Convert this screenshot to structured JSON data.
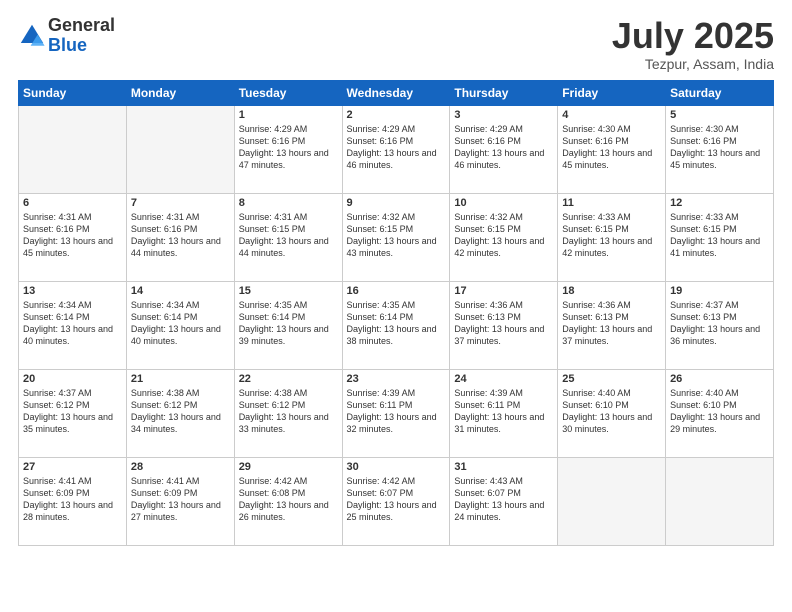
{
  "header": {
    "logo_general": "General",
    "logo_blue": "Blue",
    "month_title": "July 2025",
    "location": "Tezpur, Assam, India"
  },
  "weekdays": [
    "Sunday",
    "Monday",
    "Tuesday",
    "Wednesday",
    "Thursday",
    "Friday",
    "Saturday"
  ],
  "weeks": [
    [
      {
        "day": "",
        "info": ""
      },
      {
        "day": "",
        "info": ""
      },
      {
        "day": "1",
        "info": "Sunrise: 4:29 AM\nSunset: 6:16 PM\nDaylight: 13 hours and 47 minutes."
      },
      {
        "day": "2",
        "info": "Sunrise: 4:29 AM\nSunset: 6:16 PM\nDaylight: 13 hours and 46 minutes."
      },
      {
        "day": "3",
        "info": "Sunrise: 4:29 AM\nSunset: 6:16 PM\nDaylight: 13 hours and 46 minutes."
      },
      {
        "day": "4",
        "info": "Sunrise: 4:30 AM\nSunset: 6:16 PM\nDaylight: 13 hours and 45 minutes."
      },
      {
        "day": "5",
        "info": "Sunrise: 4:30 AM\nSunset: 6:16 PM\nDaylight: 13 hours and 45 minutes."
      }
    ],
    [
      {
        "day": "6",
        "info": "Sunrise: 4:31 AM\nSunset: 6:16 PM\nDaylight: 13 hours and 45 minutes."
      },
      {
        "day": "7",
        "info": "Sunrise: 4:31 AM\nSunset: 6:16 PM\nDaylight: 13 hours and 44 minutes."
      },
      {
        "day": "8",
        "info": "Sunrise: 4:31 AM\nSunset: 6:15 PM\nDaylight: 13 hours and 44 minutes."
      },
      {
        "day": "9",
        "info": "Sunrise: 4:32 AM\nSunset: 6:15 PM\nDaylight: 13 hours and 43 minutes."
      },
      {
        "day": "10",
        "info": "Sunrise: 4:32 AM\nSunset: 6:15 PM\nDaylight: 13 hours and 42 minutes."
      },
      {
        "day": "11",
        "info": "Sunrise: 4:33 AM\nSunset: 6:15 PM\nDaylight: 13 hours and 42 minutes."
      },
      {
        "day": "12",
        "info": "Sunrise: 4:33 AM\nSunset: 6:15 PM\nDaylight: 13 hours and 41 minutes."
      }
    ],
    [
      {
        "day": "13",
        "info": "Sunrise: 4:34 AM\nSunset: 6:14 PM\nDaylight: 13 hours and 40 minutes."
      },
      {
        "day": "14",
        "info": "Sunrise: 4:34 AM\nSunset: 6:14 PM\nDaylight: 13 hours and 40 minutes."
      },
      {
        "day": "15",
        "info": "Sunrise: 4:35 AM\nSunset: 6:14 PM\nDaylight: 13 hours and 39 minutes."
      },
      {
        "day": "16",
        "info": "Sunrise: 4:35 AM\nSunset: 6:14 PM\nDaylight: 13 hours and 38 minutes."
      },
      {
        "day": "17",
        "info": "Sunrise: 4:36 AM\nSunset: 6:13 PM\nDaylight: 13 hours and 37 minutes."
      },
      {
        "day": "18",
        "info": "Sunrise: 4:36 AM\nSunset: 6:13 PM\nDaylight: 13 hours and 37 minutes."
      },
      {
        "day": "19",
        "info": "Sunrise: 4:37 AM\nSunset: 6:13 PM\nDaylight: 13 hours and 36 minutes."
      }
    ],
    [
      {
        "day": "20",
        "info": "Sunrise: 4:37 AM\nSunset: 6:12 PM\nDaylight: 13 hours and 35 minutes."
      },
      {
        "day": "21",
        "info": "Sunrise: 4:38 AM\nSunset: 6:12 PM\nDaylight: 13 hours and 34 minutes."
      },
      {
        "day": "22",
        "info": "Sunrise: 4:38 AM\nSunset: 6:12 PM\nDaylight: 13 hours and 33 minutes."
      },
      {
        "day": "23",
        "info": "Sunrise: 4:39 AM\nSunset: 6:11 PM\nDaylight: 13 hours and 32 minutes."
      },
      {
        "day": "24",
        "info": "Sunrise: 4:39 AM\nSunset: 6:11 PM\nDaylight: 13 hours and 31 minutes."
      },
      {
        "day": "25",
        "info": "Sunrise: 4:40 AM\nSunset: 6:10 PM\nDaylight: 13 hours and 30 minutes."
      },
      {
        "day": "26",
        "info": "Sunrise: 4:40 AM\nSunset: 6:10 PM\nDaylight: 13 hours and 29 minutes."
      }
    ],
    [
      {
        "day": "27",
        "info": "Sunrise: 4:41 AM\nSunset: 6:09 PM\nDaylight: 13 hours and 28 minutes."
      },
      {
        "day": "28",
        "info": "Sunrise: 4:41 AM\nSunset: 6:09 PM\nDaylight: 13 hours and 27 minutes."
      },
      {
        "day": "29",
        "info": "Sunrise: 4:42 AM\nSunset: 6:08 PM\nDaylight: 13 hours and 26 minutes."
      },
      {
        "day": "30",
        "info": "Sunrise: 4:42 AM\nSunset: 6:07 PM\nDaylight: 13 hours and 25 minutes."
      },
      {
        "day": "31",
        "info": "Sunrise: 4:43 AM\nSunset: 6:07 PM\nDaylight: 13 hours and 24 minutes."
      },
      {
        "day": "",
        "info": ""
      },
      {
        "day": "",
        "info": ""
      }
    ]
  ]
}
